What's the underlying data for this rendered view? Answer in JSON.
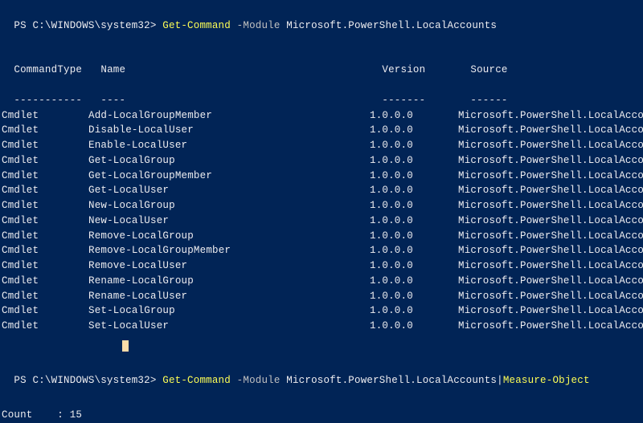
{
  "prompt1": {
    "path": "PS C:\\WINDOWS\\system32> ",
    "cmd": "Get-Command",
    "arg_flag": " -Module ",
    "arg_value": "Microsoft.PowerShell.LocalAccounts"
  },
  "table": {
    "headers": {
      "col1": "CommandType",
      "col2": "Name",
      "col3": "Version",
      "col4": "Source"
    },
    "dashes": {
      "col1": "-----------",
      "col2": "----",
      "col3": "-------",
      "col4": "------"
    },
    "rows": [
      {
        "type": "Cmdlet",
        "name": "Add-LocalGroupMember",
        "version": "1.0.0.0",
        "source": "Microsoft.PowerShell.LocalAccounts"
      },
      {
        "type": "Cmdlet",
        "name": "Disable-LocalUser",
        "version": "1.0.0.0",
        "source": "Microsoft.PowerShell.LocalAccounts"
      },
      {
        "type": "Cmdlet",
        "name": "Enable-LocalUser",
        "version": "1.0.0.0",
        "source": "Microsoft.PowerShell.LocalAccounts"
      },
      {
        "type": "Cmdlet",
        "name": "Get-LocalGroup",
        "version": "1.0.0.0",
        "source": "Microsoft.PowerShell.LocalAccounts"
      },
      {
        "type": "Cmdlet",
        "name": "Get-LocalGroupMember",
        "version": "1.0.0.0",
        "source": "Microsoft.PowerShell.LocalAccounts"
      },
      {
        "type": "Cmdlet",
        "name": "Get-LocalUser",
        "version": "1.0.0.0",
        "source": "Microsoft.PowerShell.LocalAccounts"
      },
      {
        "type": "Cmdlet",
        "name": "New-LocalGroup",
        "version": "1.0.0.0",
        "source": "Microsoft.PowerShell.LocalAccounts"
      },
      {
        "type": "Cmdlet",
        "name": "New-LocalUser",
        "version": "1.0.0.0",
        "source": "Microsoft.PowerShell.LocalAccounts"
      },
      {
        "type": "Cmdlet",
        "name": "Remove-LocalGroup",
        "version": "1.0.0.0",
        "source": "Microsoft.PowerShell.LocalAccounts"
      },
      {
        "type": "Cmdlet",
        "name": "Remove-LocalGroupMember",
        "version": "1.0.0.0",
        "source": "Microsoft.PowerShell.LocalAccounts"
      },
      {
        "type": "Cmdlet",
        "name": "Remove-LocalUser",
        "version": "1.0.0.0",
        "source": "Microsoft.PowerShell.LocalAccounts"
      },
      {
        "type": "Cmdlet",
        "name": "Rename-LocalGroup",
        "version": "1.0.0.0",
        "source": "Microsoft.PowerShell.LocalAccounts"
      },
      {
        "type": "Cmdlet",
        "name": "Rename-LocalUser",
        "version": "1.0.0.0",
        "source": "Microsoft.PowerShell.LocalAccounts"
      },
      {
        "type": "Cmdlet",
        "name": "Set-LocalGroup",
        "version": "1.0.0.0",
        "source": "Microsoft.PowerShell.LocalAccounts"
      },
      {
        "type": "Cmdlet",
        "name": "Set-LocalUser",
        "version": "1.0.0.0",
        "source": "Microsoft.PowerShell.LocalAccounts"
      }
    ]
  },
  "prompt2": {
    "path": "PS C:\\WINDOWS\\system32> ",
    "cmd": "Get-Command",
    "arg_flag": " -Module ",
    "arg_value": "Microsoft.PowerShell.LocalAccounts",
    "pipe": "|",
    "cmd2": "Measure-Object"
  },
  "output2": {
    "count_line": "Count    : 15"
  }
}
